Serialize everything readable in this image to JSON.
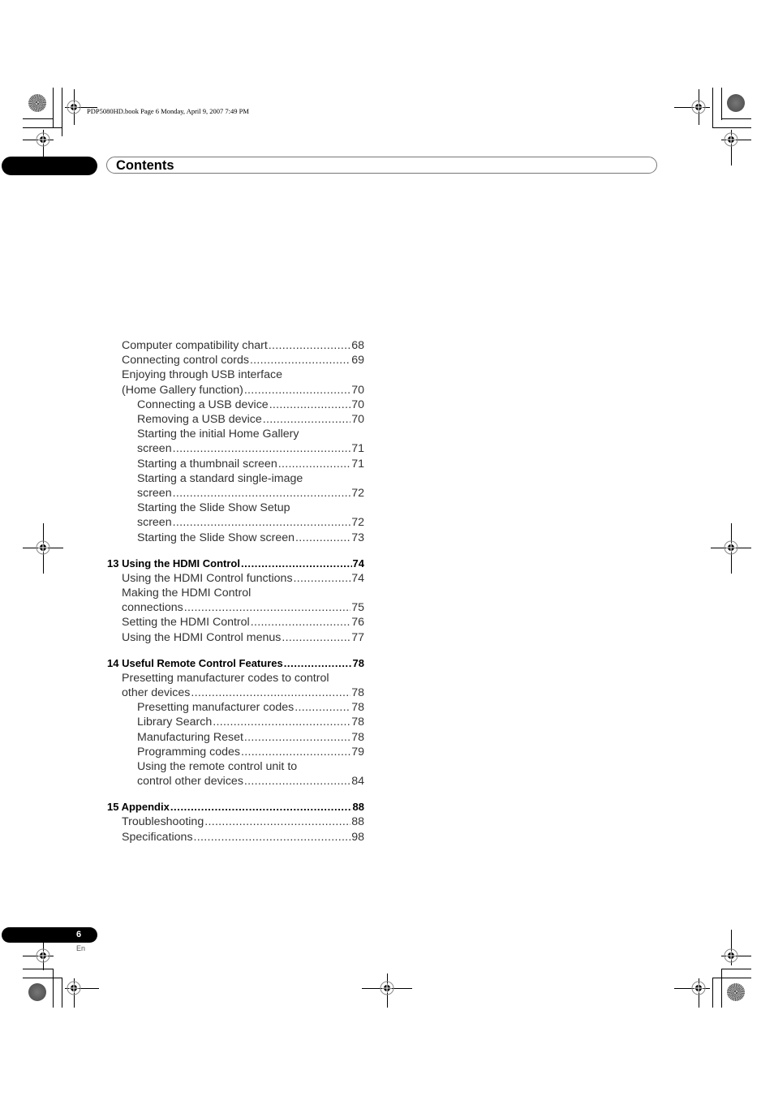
{
  "print_info": "PDP5080HD.book  Page 6  Monday, April 9, 2007  7:49 PM",
  "header": {
    "title": "Contents"
  },
  "toc": [
    {
      "type": "entry",
      "level": 1,
      "lines": [
        "Computer compatibility chart"
      ],
      "page": "68"
    },
    {
      "type": "entry",
      "level": 1,
      "lines": [
        "Connecting control cords"
      ],
      "page": "69"
    },
    {
      "type": "entry",
      "level": 1,
      "lines": [
        "Enjoying through USB interface",
        "(Home Gallery function)"
      ],
      "page": "70"
    },
    {
      "type": "entry",
      "level": 2,
      "lines": [
        "Connecting a USB device"
      ],
      "page": "70"
    },
    {
      "type": "entry",
      "level": 2,
      "lines": [
        "Removing a USB device"
      ],
      "page": "70"
    },
    {
      "type": "entry",
      "level": 2,
      "lines": [
        "Starting the initial Home Gallery",
        "screen"
      ],
      "page": "71"
    },
    {
      "type": "entry",
      "level": 2,
      "lines": [
        "Starting a thumbnail screen"
      ],
      "page": "71"
    },
    {
      "type": "entry",
      "level": 2,
      "lines": [
        "Starting a standard single-image",
        "screen"
      ],
      "page": "72"
    },
    {
      "type": "entry",
      "level": 2,
      "lines": [
        "Starting the Slide Show Setup",
        "screen"
      ],
      "page": "72"
    },
    {
      "type": "entry",
      "level": 2,
      "lines": [
        "Starting the Slide Show screen"
      ],
      "page": "73"
    },
    {
      "type": "chapter",
      "lines": [
        "13 Using the HDMI Control"
      ],
      "page": "74"
    },
    {
      "type": "entry",
      "level": 1,
      "lines": [
        "Using the HDMI Control functions"
      ],
      "page": "74"
    },
    {
      "type": "entry",
      "level": 1,
      "lines": [
        "Making the HDMI Control",
        "connections"
      ],
      "page": "75"
    },
    {
      "type": "entry",
      "level": 1,
      "lines": [
        "Setting the HDMI Control"
      ],
      "page": "76"
    },
    {
      "type": "entry",
      "level": 1,
      "lines": [
        "Using the HDMI Control menus"
      ],
      "page": "77"
    },
    {
      "type": "chapter",
      "lines": [
        "14 Useful Remote Control Features"
      ],
      "page": "78"
    },
    {
      "type": "entry",
      "level": 1,
      "lines": [
        "Presetting manufacturer codes to control",
        "other devices"
      ],
      "page": "78"
    },
    {
      "type": "entry",
      "level": 2,
      "lines": [
        "Presetting manufacturer codes"
      ],
      "page": "78"
    },
    {
      "type": "entry",
      "level": 2,
      "lines": [
        "Library Search"
      ],
      "page": "78"
    },
    {
      "type": "entry",
      "level": 2,
      "lines": [
        "Manufacturing Reset"
      ],
      "page": "78"
    },
    {
      "type": "entry",
      "level": 2,
      "lines": [
        "Programming  codes"
      ],
      "page": "79"
    },
    {
      "type": "entry",
      "level": 2,
      "lines": [
        "Using the remote control unit to",
        "control other devices"
      ],
      "page": "84"
    },
    {
      "type": "chapter",
      "lines": [
        "15 Appendix"
      ],
      "page": "88"
    },
    {
      "type": "entry",
      "level": 1,
      "lines": [
        "Troubleshooting"
      ],
      "page": "88"
    },
    {
      "type": "entry",
      "level": 1,
      "lines": [
        "Specifications"
      ],
      "page": "98"
    }
  ],
  "footer": {
    "page_number": "6",
    "language": "En"
  }
}
